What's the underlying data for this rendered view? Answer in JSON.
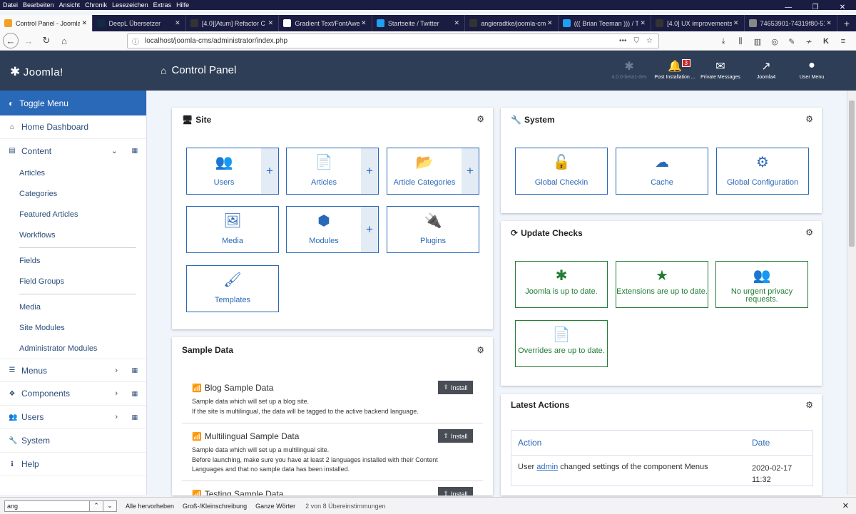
{
  "browser": {
    "menu": [
      "Datei",
      "Bearbeiten",
      "Ansicht",
      "Chronik",
      "Lesezeichen",
      "Extras",
      "Hilfe"
    ],
    "window_controls": [
      "—",
      "❐",
      "✕"
    ],
    "tabs": [
      {
        "label": "Control Panel - Joomla",
        "color": "#f4a024",
        "active": true
      },
      {
        "label": "DeepL Übersetzer",
        "color": "#0f2b46",
        "active": false
      },
      {
        "label": "[4.0][Atum] Refactor C",
        "color": "#333333",
        "active": false
      },
      {
        "label": "Gradient Text/FontAwe",
        "color": "#ffffff",
        "active": false
      },
      {
        "label": "Startseite / Twitter",
        "color": "#1da1f2",
        "active": false
      },
      {
        "label": "angieradtke/joomla-cm",
        "color": "#333333",
        "active": false
      },
      {
        "label": "((( Brian Teeman ))) / T",
        "color": "#1da1f2",
        "active": false
      },
      {
        "label": "[4.0] UX improvements",
        "color": "#333333",
        "active": false
      },
      {
        "label": "74653901-74319f80-5189-1",
        "color": "#888888",
        "active": false
      }
    ],
    "tab_close": "✕",
    "new_tab": "+",
    "url": "localhost/joomla-cms/administrator/index.php",
    "url_actions": [
      "•••",
      "⛉",
      "☆"
    ]
  },
  "joomla": {
    "brand": "Joomla!",
    "page_title": "Control Panel",
    "tools": [
      {
        "label": "4.0.0-beta1-dev",
        "icon": "joomla-icon",
        "glyph": "✱",
        "dim": true,
        "badge": ""
      },
      {
        "label": "Post Installation ...",
        "icon": "bell-icon",
        "glyph": "🔔",
        "dim": false,
        "badge": "3"
      },
      {
        "label": "Private Messages",
        "icon": "envelope-icon",
        "glyph": "✉",
        "dim": false,
        "badge": ""
      },
      {
        "label": "Joomla4",
        "icon": "external-link-icon",
        "glyph": "↗",
        "dim": false,
        "badge": ""
      },
      {
        "label": "User Menu",
        "icon": "user-icon",
        "glyph": "●",
        "dim": false,
        "badge": ""
      }
    ]
  },
  "sidebar": {
    "toggle": "Toggle Menu",
    "home": "Home Dashboard",
    "content": "Content",
    "content_items": [
      "Articles",
      "Categories",
      "Featured Articles",
      "Workflows"
    ],
    "field_items": [
      "Fields",
      "Field Groups"
    ],
    "other_items": [
      "Media",
      "Site Modules",
      "Administrator Modules"
    ],
    "menus": "Menus",
    "components": "Components",
    "users": "Users",
    "system": "System",
    "help": "Help"
  },
  "site": {
    "title": "Site",
    "items": [
      {
        "label": "Users",
        "icon": "users-icon",
        "glyph": "👥",
        "plus": true
      },
      {
        "label": "Articles",
        "icon": "file-icon",
        "glyph": "📄",
        "plus": true
      },
      {
        "label": "Article Categories",
        "icon": "folder-icon",
        "glyph": "📂",
        "plus": true
      },
      {
        "label": "Media",
        "icon": "images-icon",
        "glyph": "🖼",
        "plus": false
      },
      {
        "label": "Modules",
        "icon": "cube-icon",
        "glyph": "⬢",
        "plus": true
      },
      {
        "label": "Plugins",
        "icon": "plug-icon",
        "glyph": "🔌",
        "plus": false
      },
      {
        "label": "Templates",
        "icon": "brush-icon",
        "glyph": "🖌",
        "plus": false
      }
    ]
  },
  "system": {
    "title": "System",
    "items": [
      {
        "label": "Global Checkin",
        "icon": "unlock-icon",
        "glyph": "🔓"
      },
      {
        "label": "Cache",
        "icon": "cloud-icon",
        "glyph": "☁"
      },
      {
        "label": "Global Configuration",
        "icon": "cog-icon",
        "glyph": "⚙"
      }
    ]
  },
  "updates": {
    "title": "Update Checks",
    "items": [
      {
        "label": "Joomla is up to date.",
        "icon": "joomla-icon",
        "glyph": "✱"
      },
      {
        "label": "Extensions are up to date.",
        "icon": "star-icon",
        "glyph": "★"
      },
      {
        "label": "No urgent privacy requests.",
        "icon": "users-icon",
        "glyph": "👥"
      },
      {
        "label": "Overrides are up to date.",
        "icon": "file-icon",
        "glyph": "📄"
      }
    ]
  },
  "sample": {
    "title": "Sample Data",
    "install_label": "Install",
    "items": [
      {
        "title": "Blog Sample Data",
        "lines": [
          "Sample data which will set up a blog site.",
          "If the site is multilingual, the data will be tagged to the active backend language."
        ]
      },
      {
        "title": "Multilingual Sample Data",
        "lines": [
          "Sample data which will set up a multilingual site.",
          "Before launching, make sure you have at least 2 languages installed with their Content",
          "Languages and that no sample data has been installed."
        ]
      },
      {
        "title": "Testing Sample Data",
        "lines": []
      }
    ]
  },
  "latest": {
    "title": "Latest Actions",
    "col_action": "Action",
    "col_date": "Date",
    "row_prefix": "User ",
    "row_user": "admin",
    "row_suffix": " changed settings of the component Menus",
    "row_date_1": "2020-02-17",
    "row_date_2": "11:32"
  },
  "find": {
    "query": "ang",
    "opt_highlight": "Alle hervorheben",
    "opt_case": "Groß-/Kleinschreibung",
    "opt_words": "Ganze Wörter",
    "result": "2 von 8 Übereinstimmungen"
  },
  "colors": {
    "header": "#2f3e57",
    "primary": "#2a69b8",
    "success": "#227d35"
  }
}
